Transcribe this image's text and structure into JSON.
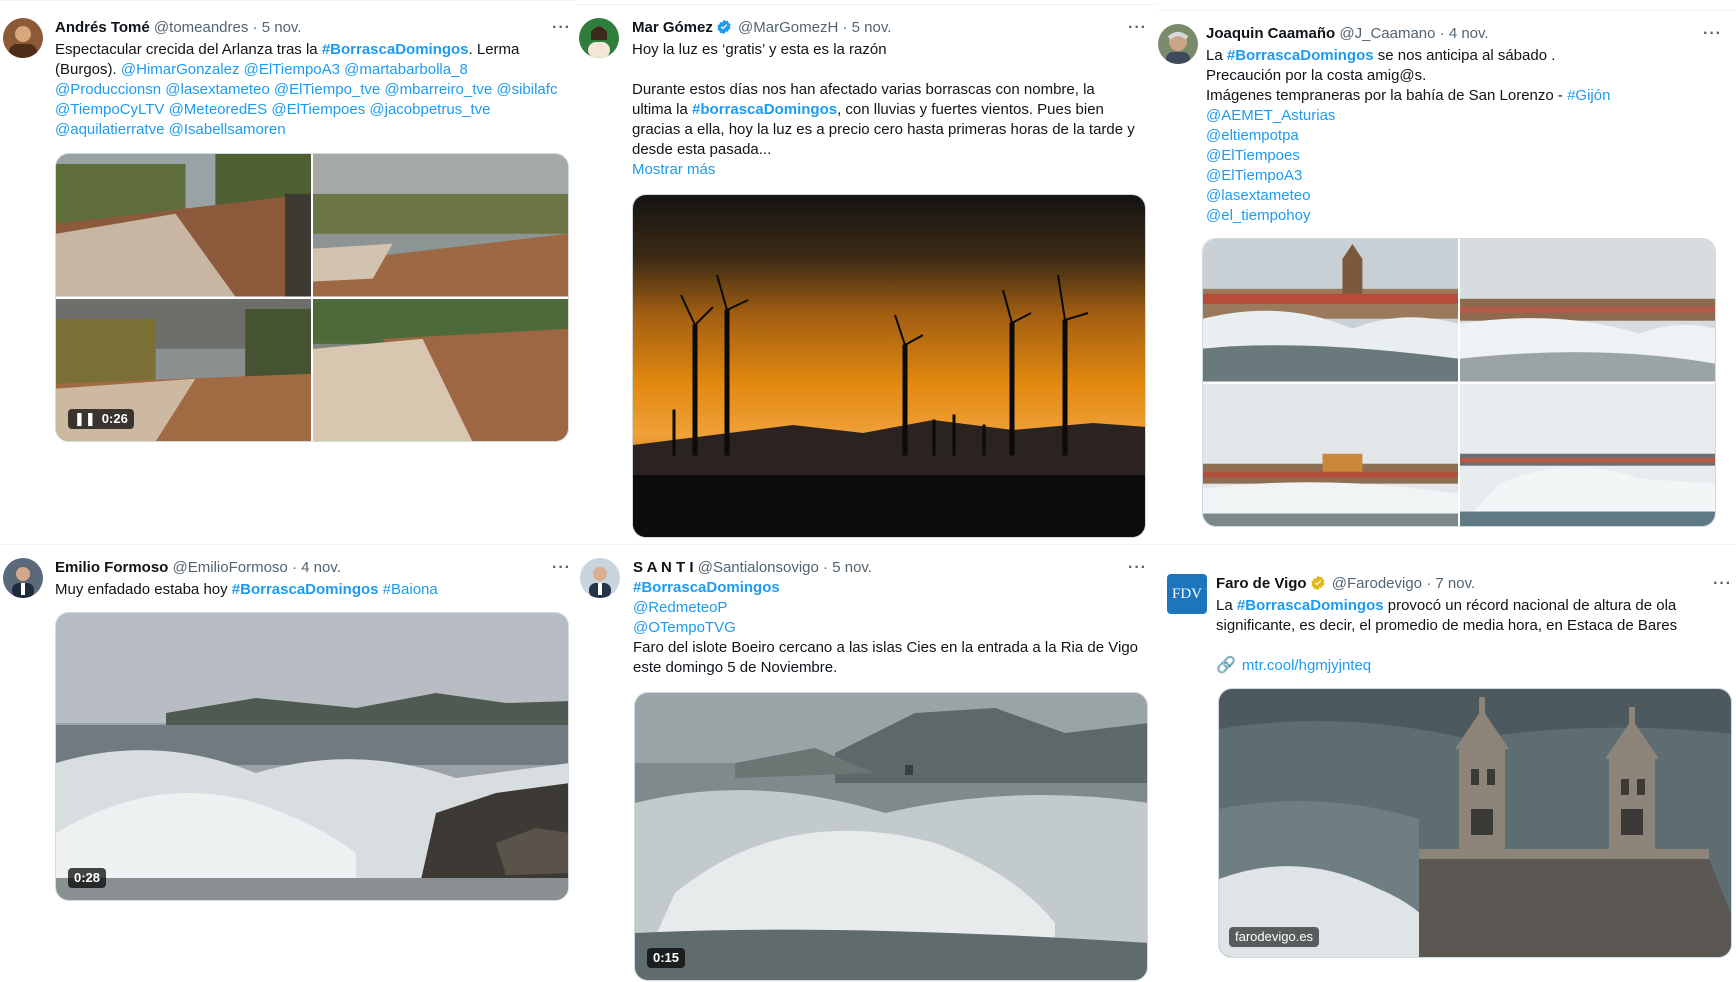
{
  "tweets": [
    {
      "name": "Andrés Tomé",
      "handle": "@tomeandres",
      "dot": "·",
      "date": "5 nov.",
      "more": "···",
      "text_l1_a": "Espectacular crecida del Arlanza tras la ",
      "text_l1_tag": "#BorrascaDomingos",
      "text_l1_b": ". Lerma",
      "text_l2_a": "(Burgos). ",
      "text_l2_b": "@HimarGonzalez @ElTiempoA3 @martabarbolla_8",
      "text_l3": "@Produccionsn @lasextameteo @ElTiempo_tve @mbarreiro_tve @sibilafc",
      "text_l4": "@TiempoCyLTV @MeteoredES @ElTiempoes @jacobpetrus_tve",
      "text_l5": "@aquilatierratve @Isabellsamoren",
      "video_duration": "0:26",
      "pause_icon": "❚❚"
    },
    {
      "name": "Mar Gómez",
      "handle": "@MarGomezH",
      "dot": "·",
      "date": "5 nov.",
      "more": "···",
      "text_l1": "Hoy la luz es ‘gratis’ y esta es la razón",
      "text_l2": "Durante estos días nos han afectado varias borrascas con nombre, la",
      "text_l3_a": "ultima la ",
      "text_l3_tag": "#borrascaDomingos",
      "text_l3_b": ", con lluvias y fuertes vientos. Pues bien",
      "text_l4": "gracias a ella, hoy la luz es a precio cero hasta primeras horas de la tarde y",
      "text_l5": "desde esta pasada...",
      "show_more": "Mostrar más"
    },
    {
      "name": "Joaquin Caamaño",
      "handle": "@J_Caamano",
      "dot": "·",
      "date": "4 nov.",
      "more": "···",
      "text_l1_a": "La ",
      "text_l1_tag": "#BorrascaDomingos",
      "text_l1_b": " se nos anticipa al sábado .",
      "text_l2": "Precaución por la costa amig@s.",
      "text_l3_a": "Imágenes tempraneras por la bahía de San Lorenzo - ",
      "text_l3_tag": "#Gijón",
      "text_l4": "@AEMET_Asturias",
      "text_l5": "@eltiempotpa",
      "text_l6": "@ElTiempoes",
      "text_l7": "@ElTiempoA3",
      "text_l8": "@lasextameteo",
      "text_l9": "@el_tiempohoy"
    },
    {
      "name": "Emilio Formoso",
      "handle": "@EmilioFormoso",
      "dot": "·",
      "date": "4 nov.",
      "more": "···",
      "text_l1_a": "Muy enfadado estaba hoy ",
      "text_l1_tag": "#BorrascaDomingos",
      "text_l1_b": " #Baiona",
      "video_duration": "0:28"
    },
    {
      "name": "S A N T I",
      "handle": "@Santialonsovigo",
      "dot": "·",
      "date": "5 nov.",
      "more": "···",
      "text_l1_tag": "#BorrascaDomingos",
      "text_l2": "@RedmeteoP",
      "text_l3": "@OTempoTVG",
      "text_l4": "Faro del islote Boeiro cercano a las islas Cies en la entrada a la Ria de Vigo",
      "text_l5": "este domingo 5 de Noviembre.",
      "video_duration": "0:15"
    },
    {
      "name": "Faro de Vigo",
      "handle": "@Farodevigo",
      "dot": "·",
      "date": "7 nov.",
      "more": "···",
      "avatar_text": "FDV",
      "text_l1_a": "La ",
      "text_l1_tag": "#BorrascaDomingos",
      "text_l1_b": " provocó un récord nacional de altura de ola",
      "text_l2": "significante, es decir, el promedio de media hora, en Estaca de Bares",
      "link": "mtr.cool/hgmjyjnteq",
      "site": "farodevigo.es"
    }
  ],
  "colors": {
    "link_blue": "#1d9bf0",
    "verified_blue": "#1d9bf0",
    "verified_gold": "#e2b719",
    "secondary_text": "#536471"
  }
}
